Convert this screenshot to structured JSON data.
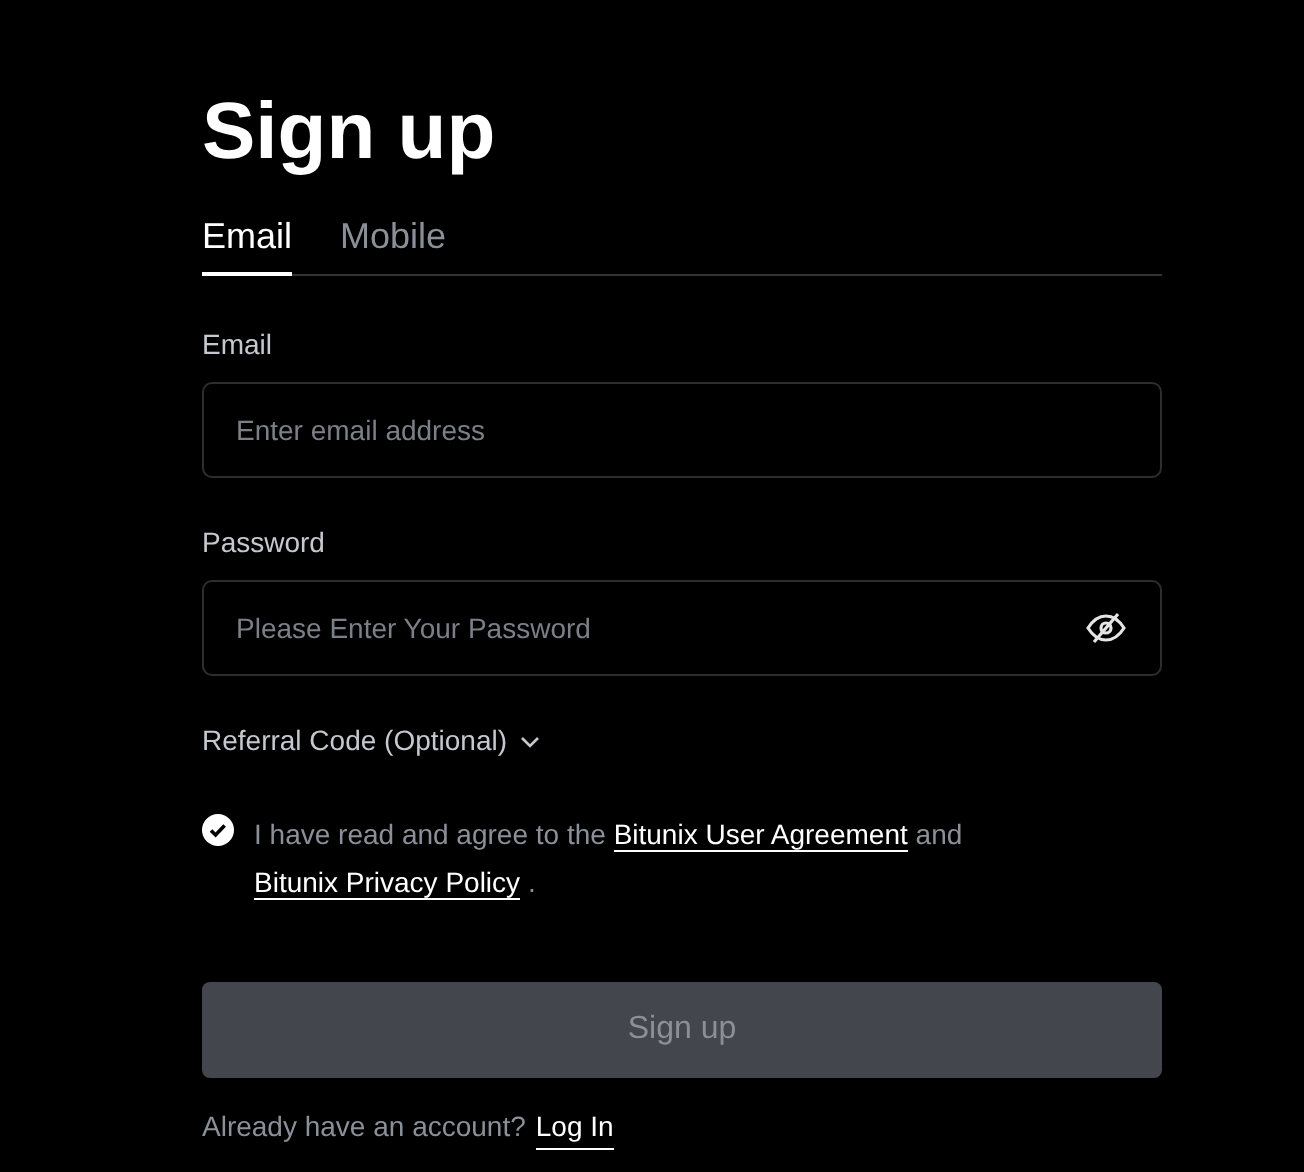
{
  "title": "Sign up",
  "tabs": [
    {
      "label": "Email",
      "selected": true
    },
    {
      "label": "Mobile",
      "selected": false
    }
  ],
  "fields": [
    {
      "label": "Email",
      "placeholder": "Enter email address",
      "kind": "text"
    },
    {
      "label": "Password",
      "placeholder": "Please Enter Your Password",
      "kind": "password"
    }
  ],
  "referral": {
    "label": "Referral Code (Optional)",
    "expanded": false
  },
  "agreement": {
    "checked": true,
    "parts": [
      {
        "kind": "text",
        "text": "I have read and agree to the"
      },
      {
        "kind": "link",
        "text": "Bitunix User Agreement"
      },
      {
        "kind": "text",
        "text": "and"
      },
      {
        "kind": "link",
        "text": "Bitunix Privacy Policy"
      },
      {
        "kind": "text",
        "text": "."
      }
    ]
  },
  "submit": {
    "label": "Sign up",
    "disabled": true
  },
  "footer": {
    "text": "Already have an account?",
    "link": "Log In"
  }
}
